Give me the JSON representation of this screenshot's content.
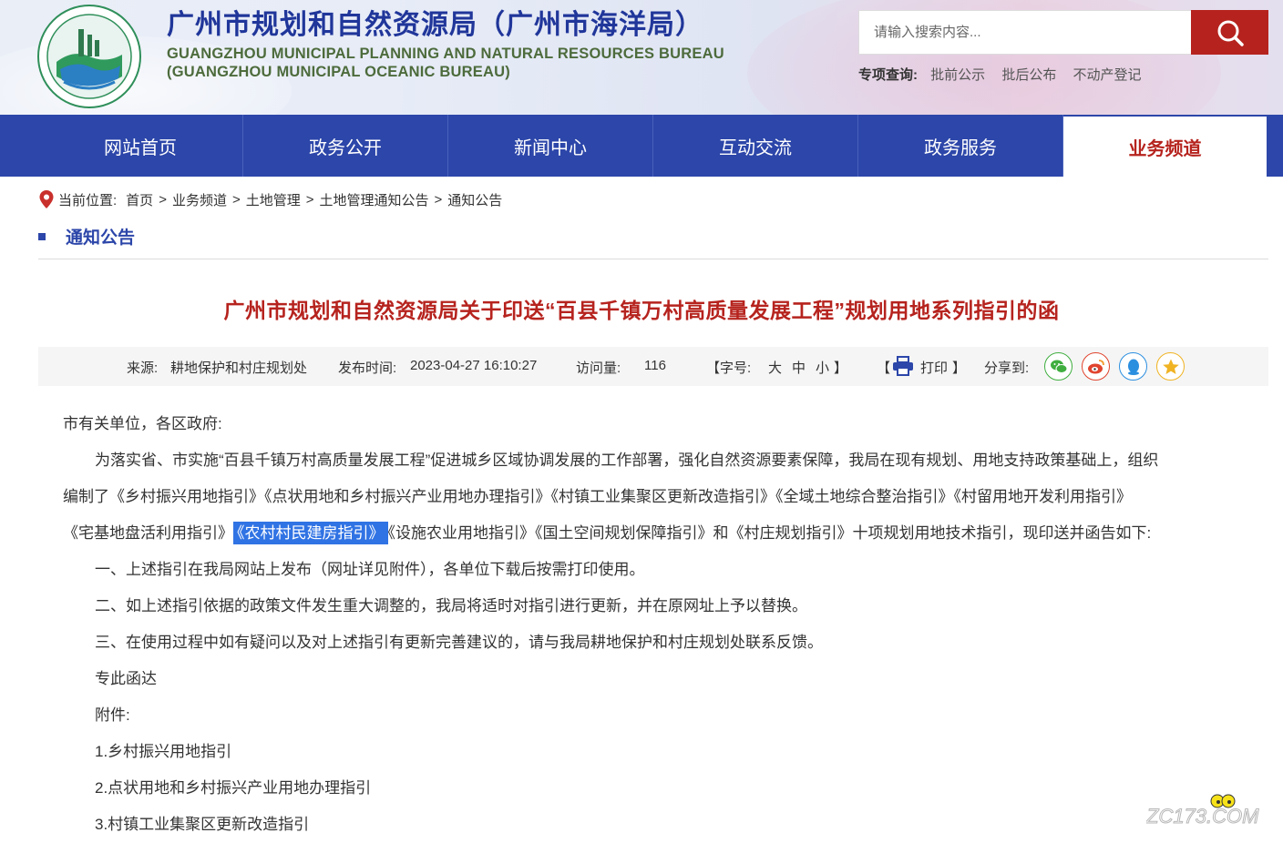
{
  "header": {
    "title_cn": "广州市规划和自然资源局（广州市海洋局）",
    "title_en_1": "GUANGZHOU MUNICIPAL PLANNING AND NATURAL RESOURCES BUREAU",
    "title_en_2": "(GUANGZHOU MUNICIPAL OCEANIC BUREAU)",
    "search_placeholder": "请输入搜索内容...",
    "special_label": "专项查询:",
    "special_links": [
      "批前公示",
      "批后公布",
      "不动产登记"
    ]
  },
  "nav": {
    "items": [
      "网站首页",
      "政务公开",
      "新闻中心",
      "互动交流",
      "政务服务",
      "业务频道"
    ],
    "active_index": 5
  },
  "breadcrumb": {
    "label": "当前位置:",
    "items": [
      "首页",
      "业务频道",
      "土地管理",
      "土地管理通知公告",
      "通知公告"
    ],
    "separator": ">"
  },
  "section_title": "通知公告",
  "article": {
    "title": "广州市规划和自然资源局关于印送“百县千镇万村高质量发展工程”规划用地系列指引的函",
    "meta": {
      "source_label": "来源:",
      "source": "耕地保护和村庄规划处",
      "time_label": "发布时间:",
      "time": "2023-04-27 16:10:27",
      "visits_label": "访问量:",
      "visits": "116",
      "font_open": "【字号:",
      "font_large": "大",
      "font_medium": "中",
      "font_small": "小",
      "font_close": "】",
      "print_open": "【",
      "print": "打印",
      "print_close": "】",
      "share_label": "分享到:"
    },
    "salutation": "市有关单位，各区政府:",
    "para1_line1": "为落实省、市实施“百县千镇万村高质量发展工程”促进城乡区域协调发展的工作部署，强化自然资源要素保障，我局在现有规划、用地支持政策基础上，组织",
    "para1_line2": "编制了《乡村振兴用地指引》《点状用地和乡村振兴产业用地办理指引》《村镇工业集聚区更新改造指引》《全域土地综合整治指引》《村留用地开发利用指引》",
    "para1_line3_before": "《宅基地盘活利用指引》",
    "para1_line3_highlight": "《农村村民建房指引》",
    "para1_line3_after": "《设施农业用地指引》《国土空间规划保障指引》和《村庄规划指引》十项规划用地技术指引，现印送并函告如下:",
    "item1": "一、上述指引在我局网站上发布（网址详见附件），各单位下载后按需打印使用。",
    "item2": "二、如上述指引依据的政策文件发生重大调整的，我局将适时对指引进行更新，并在原网址上予以替换。",
    "item3": "三、在使用过程中如有疑问以及对上述指引有更新完善建议的，请与我局耕地保护和村庄规划处联系反馈。",
    "closing": "专此函达",
    "attachments_label": "附件:",
    "attachments": [
      "1.乡村振兴用地指引",
      "2.点状用地和乡村振兴产业用地办理指引",
      "3.村镇工业集聚区更新改造指引"
    ]
  },
  "watermark": "ZC173.COM",
  "colors": {
    "nav_bg": "#2c46a9",
    "accent_red": "#b6231e",
    "highlight": "#3073e4"
  },
  "icons": [
    "logo-emblem",
    "search-icon",
    "location-pin-icon",
    "printer-icon",
    "wechat-icon",
    "weibo-icon",
    "qq-icon",
    "qzone-star-icon"
  ]
}
